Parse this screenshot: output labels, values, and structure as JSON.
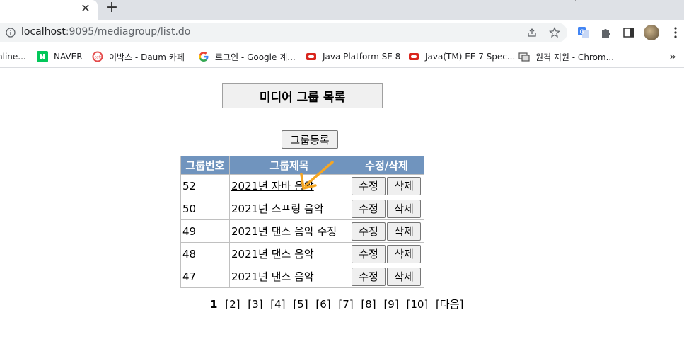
{
  "browser": {
    "tab_close_glyph": "✕",
    "new_tab_glyph": "+",
    "url_host": "localhost",
    "url_rest": ":9095/mediagroup/list.do",
    "more_bookmarks_glyph": "»"
  },
  "bookmarks": [
    {
      "label": "nline...",
      "icon": "generic-icon"
    },
    {
      "label": "NAVER",
      "icon": "naver-icon",
      "color": "#03c75a"
    },
    {
      "label": "이박스 - Daum 카페",
      "icon": "daum-cafe-icon",
      "color": "#e44b4b"
    },
    {
      "label": "로그인 - Google 계...",
      "icon": "google-icon"
    },
    {
      "label": "Java Platform SE 8",
      "icon": "oracle-icon",
      "color": "#d9251d"
    },
    {
      "label": "Java(TM) EE 7 Spec...",
      "icon": "oracle-icon",
      "color": "#d9251d"
    },
    {
      "label": "원격 지원 - Chrom...",
      "icon": "remote-desktop-icon"
    }
  ],
  "page": {
    "title": "미디어 그룹 목록",
    "register_button": "그룹등록",
    "table": {
      "headers": [
        "그룹번호",
        "그룹제목",
        "수정/삭제"
      ],
      "edit_label": "수정",
      "delete_label": "삭제",
      "rows": [
        {
          "no": "52",
          "title": "2021년 자바 음악"
        },
        {
          "no": "50",
          "title": "2021년 스프링 음악"
        },
        {
          "no": "49",
          "title": "2021년 댄스 음악 수정"
        },
        {
          "no": "48",
          "title": "2021년 댄스 음악"
        },
        {
          "no": "47",
          "title": "2021년 댄스 음악"
        }
      ]
    },
    "pagination": {
      "current": "1",
      "pages": [
        "[2]",
        "[3]",
        "[4]",
        "[5]",
        "[6]",
        "[7]",
        "[8]",
        "[9]",
        "[10]"
      ],
      "next": "[다음]"
    }
  },
  "colors": {
    "header_bg": "#7094be",
    "cursor_annotation": "#f5a623"
  }
}
